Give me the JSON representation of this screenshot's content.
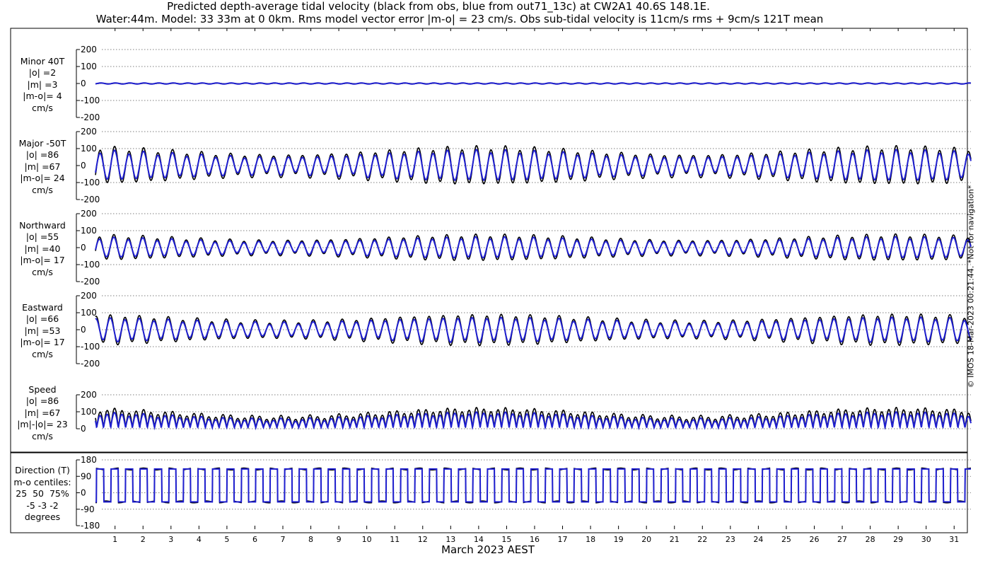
{
  "title_line1": "Predicted depth-average tidal velocity (black from obs, blue from out71_13c) at CW2A1 40.6S 148.1E.",
  "title_line2": "Water:44m. Model: 33 33m at 0 0km. Rms model vector error |m-o| = 23 cm/s. Obs sub-tidal velocity is 11cm/s rms + 9cm/s 121T mean",
  "watermark": "© IMOS 18-Mar-2023 00:21:44. *Not for navigation*",
  "colors": {
    "obs": "#000000",
    "model": "#1f1fd0",
    "grid": "#555555"
  },
  "chart_data": {
    "type": "line",
    "xlabel": "March 2023 AEST",
    "x_ticks": [
      "1",
      "2",
      "3",
      "4",
      "5",
      "6",
      "7",
      "8",
      "9",
      "10",
      "11",
      "12",
      "13",
      "14",
      "15",
      "16",
      "17",
      "18",
      "19",
      "20",
      "21",
      "22",
      "23",
      "24",
      "25",
      "26",
      "27",
      "28",
      "29",
      "30",
      "31"
    ],
    "series_legend": [
      "black from obs",
      "blue from out71_13c"
    ],
    "panels": [
      {
        "id": "minor",
        "label_lines": [
          "Minor 40T",
          "|o| =2",
          "|m| =3",
          "|m-o|= 4",
          "cm/s"
        ],
        "ylim": [
          -200,
          200
        ],
        "yticks": [
          "200",
          "100",
          "0",
          "-100",
          "-200"
        ],
        "obs_amplitude": 2,
        "model_amplitude": 3,
        "unit": "cm/s"
      },
      {
        "id": "major",
        "label_lines": [
          "Major -50T",
          "|o| =86",
          "|m| =67",
          "|m-o|= 24",
          "cm/s"
        ],
        "ylim": [
          -200,
          200
        ],
        "yticks": [
          "200",
          "100",
          "0",
          "-100",
          "-200"
        ],
        "obs_amplitude": 86,
        "model_amplitude": 67,
        "unit": "cm/s"
      },
      {
        "id": "north",
        "label_lines": [
          "Northward",
          "|o| =55",
          "|m| =40",
          "|m-o|= 17",
          "cm/s"
        ],
        "ylim": [
          -200,
          200
        ],
        "yticks": [
          "200",
          "100",
          "0",
          "-100",
          "-200"
        ],
        "obs_amplitude": 55,
        "model_amplitude": 40,
        "unit": "cm/s"
      },
      {
        "id": "east",
        "label_lines": [
          "Eastward",
          "|o| =66",
          "|m| =53",
          "|m-o|= 17",
          "cm/s"
        ],
        "ylim": [
          -200,
          200
        ],
        "yticks": [
          "200",
          "100",
          "0",
          "-100",
          "-200"
        ],
        "obs_amplitude": 66,
        "model_amplitude": 53,
        "unit": "cm/s"
      },
      {
        "id": "speed",
        "label_lines": [
          "Speed",
          "|o| =86",
          "|m| =67",
          "|m|-|o|= 23",
          "cm/s"
        ],
        "ylim": [
          0,
          200
        ],
        "yticks": [
          "200",
          "100",
          "0"
        ],
        "obs_amplitude": 86,
        "model_amplitude": 67,
        "unit": "cm/s"
      },
      {
        "id": "direction",
        "label_lines": [
          "Direction (T)",
          "m-o centiles:",
          "25  50  75%",
          "-5 -3 -2",
          "degrees"
        ],
        "ylim": [
          -180,
          180
        ],
        "yticks": [
          "180",
          "90",
          "0",
          "-90",
          "-180"
        ],
        "unit": "degrees",
        "centiles": {
          "p25": -5,
          "p50": -3,
          "p75": -2
        }
      }
    ]
  }
}
